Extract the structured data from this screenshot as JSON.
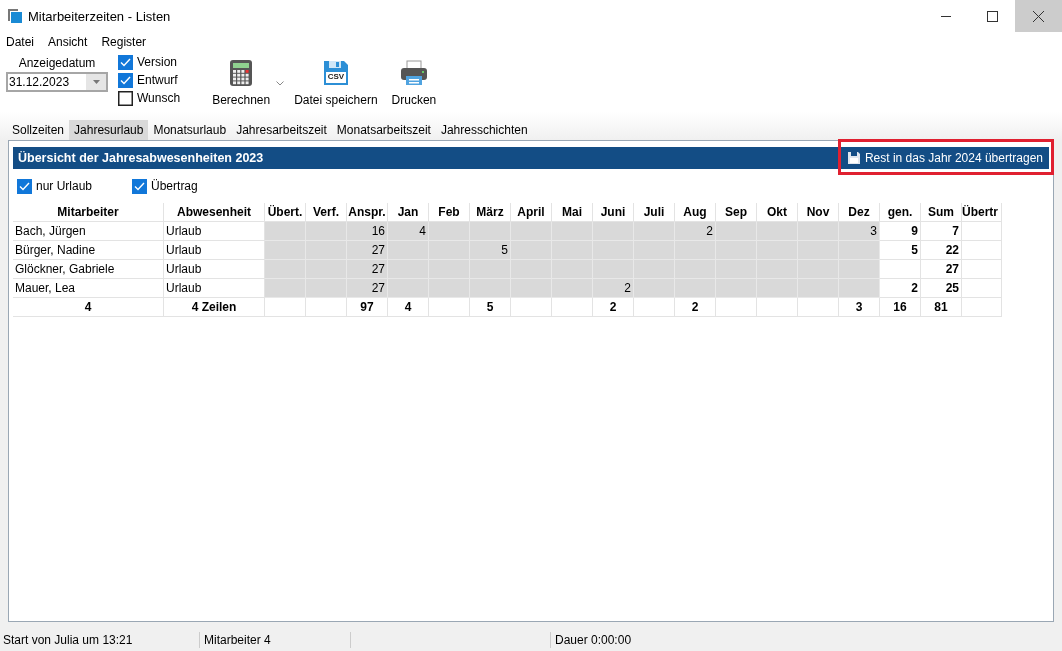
{
  "window": {
    "title": "Mitarbeiterzeiten - Listen"
  },
  "menu": [
    "Datei",
    "Ansicht",
    "Register"
  ],
  "toolbar": {
    "date_label": "Anzeigedatum",
    "date_value": "31.12.2023",
    "options": [
      {
        "label": "Version",
        "checked": true
      },
      {
        "label": "Entwurf",
        "checked": true
      },
      {
        "label": "Wunsch",
        "checked": false
      }
    ],
    "buttons": [
      {
        "kind": "calculator",
        "label": "Berechnen",
        "dropdown": true
      },
      {
        "kind": "csv",
        "label": "Datei speichern",
        "dropdown": false,
        "icon_text": "CSV"
      },
      {
        "kind": "printer",
        "label": "Drucken",
        "dropdown": false
      }
    ]
  },
  "tabs": [
    {
      "label": "Sollzeiten",
      "selected": false
    },
    {
      "label": "Jahresurlaub",
      "selected": true
    },
    {
      "label": "Monatsurlaub",
      "selected": false
    },
    {
      "label": "Jahresarbeitszeit",
      "selected": false
    },
    {
      "label": "Monatsarbeitszeit",
      "selected": false
    },
    {
      "label": "Jahresschichten",
      "selected": false
    }
  ],
  "panel": {
    "title": "Übersicht der Jahresabwesenheiten 2023",
    "action": "Rest in das Jahr 2024 übertragen",
    "action_highlighted": true,
    "filters": [
      {
        "label": "nur Urlaub",
        "checked": true
      },
      {
        "label": "Übertrag",
        "checked": true
      }
    ]
  },
  "table": {
    "columns": [
      "Mitarbeiter",
      "Abwesenheit",
      "Übert.",
      "Verf.",
      "Anspr.",
      "Jan",
      "Feb",
      "März",
      "April",
      "Mai",
      "Juni",
      "Juli",
      "Aug",
      "Sep",
      "Okt",
      "Nov",
      "Dez",
      "gen.",
      "Sum",
      "Übertr"
    ],
    "rows": [
      {
        "employee": "Bach, Jürgen",
        "absence": "Urlaub",
        "anspr": "16",
        "jan": "4",
        "aug": "2",
        "dez": "3",
        "gen": "9",
        "sum": "7"
      },
      {
        "employee": "Bürger, Nadine",
        "absence": "Urlaub",
        "anspr": "27",
        "maerz": "5",
        "gen": "5",
        "sum": "22"
      },
      {
        "employee": "Glöckner, Gabriele",
        "absence": "Urlaub",
        "anspr": "27",
        "sum": "27"
      },
      {
        "employee": "Mauer, Lea",
        "absence": "Urlaub",
        "anspr": "27",
        "juni": "2",
        "gen": "2",
        "sum": "25"
      }
    ],
    "totals": {
      "employee": "4",
      "absence": "4 Zeilen",
      "anspr": "97",
      "jan": "4",
      "maerz": "5",
      "juni": "2",
      "aug": "2",
      "dez": "3",
      "gen": "16",
      "sum": "81"
    }
  },
  "status_bar": {
    "start": "Start von Julia um 13:21",
    "count": "Mitarbeiter 4",
    "duration": "Dauer 0:00:00"
  }
}
